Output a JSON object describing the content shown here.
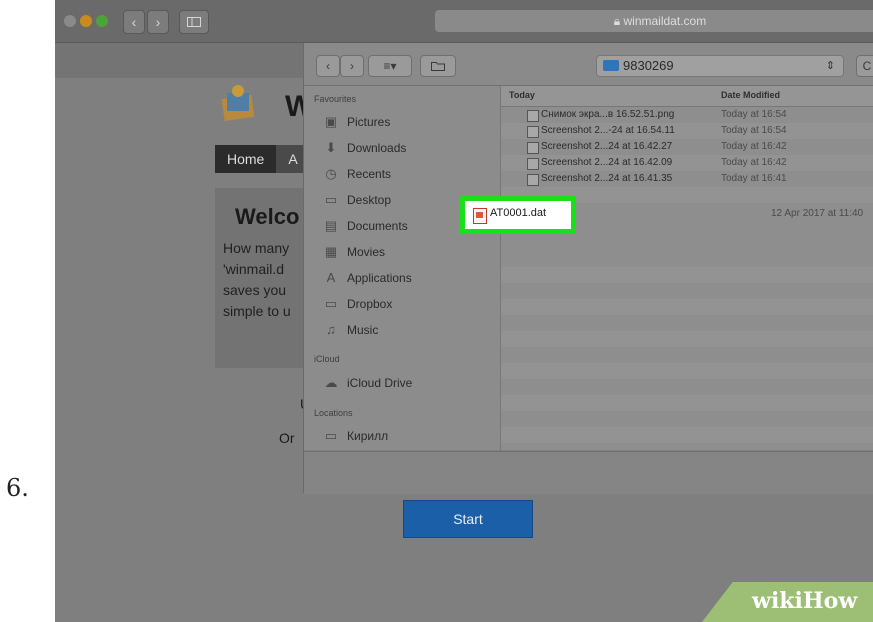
{
  "step": {
    "number": "6."
  },
  "browser": {
    "url": "winmaildat.com",
    "back_glyph": "‹",
    "forward_glyph": "›"
  },
  "site": {
    "title": "W",
    "nav": {
      "home": "Home",
      "about": "A"
    },
    "welcome_title": "Welco",
    "welcome_lines": [
      "How many",
      "'winmail.d",
      "saves you",
      "simple to u"
    ],
    "fragment1": "U",
    "fragment2": "Or",
    "start_label": "Start"
  },
  "dialog": {
    "view_label": "≡▾",
    "folder_name": "9830269",
    "sidebar": {
      "favourites_title": "Favourites",
      "favourites": [
        {
          "label": "Pictures",
          "icon": "camera-icon",
          "glyph": "▣"
        },
        {
          "label": "Downloads",
          "icon": "download-icon",
          "glyph": "⬇"
        },
        {
          "label": "Recents",
          "icon": "clock-icon",
          "glyph": "◷"
        },
        {
          "label": "Desktop",
          "icon": "desktop-icon",
          "glyph": "▭"
        },
        {
          "label": "Documents",
          "icon": "document-icon",
          "glyph": "▤"
        },
        {
          "label": "Movies",
          "icon": "film-icon",
          "glyph": "▦"
        },
        {
          "label": "Applications",
          "icon": "applications-icon",
          "glyph": "A"
        },
        {
          "label": "Dropbox",
          "icon": "folder-icon",
          "glyph": "▭"
        },
        {
          "label": "Music",
          "icon": "music-icon",
          "glyph": "♫"
        }
      ],
      "icloud_title": "iCloud",
      "icloud_items": [
        {
          "label": "iCloud Drive",
          "icon": "cloud-icon",
          "glyph": "☁"
        }
      ],
      "locations_title": "Locations",
      "locations": [
        {
          "label": "Кирилл",
          "icon": "computer-icon",
          "glyph": "▭"
        }
      ]
    },
    "columns": {
      "name": "Today",
      "date": "Date Modified"
    },
    "files": [
      {
        "name": "Снимок экра...в 16.52.51.png",
        "date": "Today at 16:54"
      },
      {
        "name": "Screenshot 2...-24 at 16.54.11",
        "date": "Today at 16:54"
      },
      {
        "name": "Screenshot 2...24 at 16.42.27",
        "date": "Today at 16:42"
      },
      {
        "name": "Screenshot 2...24 at 16.42.09",
        "date": "Today at 16:42"
      },
      {
        "name": "Screenshot 2...24 at 16.41.35",
        "date": "Today at 16:41"
      }
    ],
    "selected_file": {
      "name": "AT0001.dat",
      "date": "12 Apr 2017 at 11:40"
    }
  },
  "watermark": "wikiHow",
  "colors": {
    "highlight": "#19e019",
    "start_button": "#1a5fa8",
    "wikihow_green": "#9cbf75"
  }
}
